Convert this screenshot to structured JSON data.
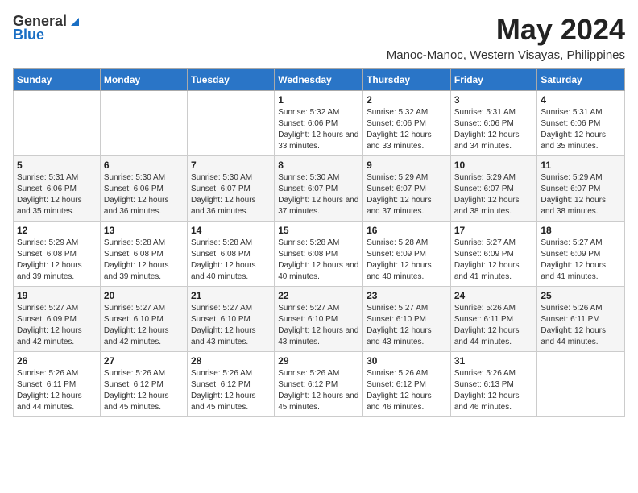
{
  "logo": {
    "general": "General",
    "blue": "Blue"
  },
  "title": "May 2024",
  "location": "Manoc-Manoc, Western Visayas, Philippines",
  "days_header": [
    "Sunday",
    "Monday",
    "Tuesday",
    "Wednesday",
    "Thursday",
    "Friday",
    "Saturday"
  ],
  "weeks": [
    [
      {
        "day": "",
        "content": ""
      },
      {
        "day": "",
        "content": ""
      },
      {
        "day": "",
        "content": ""
      },
      {
        "day": "1",
        "content": "Sunrise: 5:32 AM\nSunset: 6:06 PM\nDaylight: 12 hours and 33 minutes."
      },
      {
        "day": "2",
        "content": "Sunrise: 5:32 AM\nSunset: 6:06 PM\nDaylight: 12 hours and 33 minutes."
      },
      {
        "day": "3",
        "content": "Sunrise: 5:31 AM\nSunset: 6:06 PM\nDaylight: 12 hours and 34 minutes."
      },
      {
        "day": "4",
        "content": "Sunrise: 5:31 AM\nSunset: 6:06 PM\nDaylight: 12 hours and 35 minutes."
      }
    ],
    [
      {
        "day": "5",
        "content": "Sunrise: 5:31 AM\nSunset: 6:06 PM\nDaylight: 12 hours and 35 minutes."
      },
      {
        "day": "6",
        "content": "Sunrise: 5:30 AM\nSunset: 6:06 PM\nDaylight: 12 hours and 36 minutes."
      },
      {
        "day": "7",
        "content": "Sunrise: 5:30 AM\nSunset: 6:07 PM\nDaylight: 12 hours and 36 minutes."
      },
      {
        "day": "8",
        "content": "Sunrise: 5:30 AM\nSunset: 6:07 PM\nDaylight: 12 hours and 37 minutes."
      },
      {
        "day": "9",
        "content": "Sunrise: 5:29 AM\nSunset: 6:07 PM\nDaylight: 12 hours and 37 minutes."
      },
      {
        "day": "10",
        "content": "Sunrise: 5:29 AM\nSunset: 6:07 PM\nDaylight: 12 hours and 38 minutes."
      },
      {
        "day": "11",
        "content": "Sunrise: 5:29 AM\nSunset: 6:07 PM\nDaylight: 12 hours and 38 minutes."
      }
    ],
    [
      {
        "day": "12",
        "content": "Sunrise: 5:29 AM\nSunset: 6:08 PM\nDaylight: 12 hours and 39 minutes."
      },
      {
        "day": "13",
        "content": "Sunrise: 5:28 AM\nSunset: 6:08 PM\nDaylight: 12 hours and 39 minutes."
      },
      {
        "day": "14",
        "content": "Sunrise: 5:28 AM\nSunset: 6:08 PM\nDaylight: 12 hours and 40 minutes."
      },
      {
        "day": "15",
        "content": "Sunrise: 5:28 AM\nSunset: 6:08 PM\nDaylight: 12 hours and 40 minutes."
      },
      {
        "day": "16",
        "content": "Sunrise: 5:28 AM\nSunset: 6:09 PM\nDaylight: 12 hours and 40 minutes."
      },
      {
        "day": "17",
        "content": "Sunrise: 5:27 AM\nSunset: 6:09 PM\nDaylight: 12 hours and 41 minutes."
      },
      {
        "day": "18",
        "content": "Sunrise: 5:27 AM\nSunset: 6:09 PM\nDaylight: 12 hours and 41 minutes."
      }
    ],
    [
      {
        "day": "19",
        "content": "Sunrise: 5:27 AM\nSunset: 6:09 PM\nDaylight: 12 hours and 42 minutes."
      },
      {
        "day": "20",
        "content": "Sunrise: 5:27 AM\nSunset: 6:10 PM\nDaylight: 12 hours and 42 minutes."
      },
      {
        "day": "21",
        "content": "Sunrise: 5:27 AM\nSunset: 6:10 PM\nDaylight: 12 hours and 43 minutes."
      },
      {
        "day": "22",
        "content": "Sunrise: 5:27 AM\nSunset: 6:10 PM\nDaylight: 12 hours and 43 minutes."
      },
      {
        "day": "23",
        "content": "Sunrise: 5:27 AM\nSunset: 6:10 PM\nDaylight: 12 hours and 43 minutes."
      },
      {
        "day": "24",
        "content": "Sunrise: 5:26 AM\nSunset: 6:11 PM\nDaylight: 12 hours and 44 minutes."
      },
      {
        "day": "25",
        "content": "Sunrise: 5:26 AM\nSunset: 6:11 PM\nDaylight: 12 hours and 44 minutes."
      }
    ],
    [
      {
        "day": "26",
        "content": "Sunrise: 5:26 AM\nSunset: 6:11 PM\nDaylight: 12 hours and 44 minutes."
      },
      {
        "day": "27",
        "content": "Sunrise: 5:26 AM\nSunset: 6:12 PM\nDaylight: 12 hours and 45 minutes."
      },
      {
        "day": "28",
        "content": "Sunrise: 5:26 AM\nSunset: 6:12 PM\nDaylight: 12 hours and 45 minutes."
      },
      {
        "day": "29",
        "content": "Sunrise: 5:26 AM\nSunset: 6:12 PM\nDaylight: 12 hours and 45 minutes."
      },
      {
        "day": "30",
        "content": "Sunrise: 5:26 AM\nSunset: 6:12 PM\nDaylight: 12 hours and 46 minutes."
      },
      {
        "day": "31",
        "content": "Sunrise: 5:26 AM\nSunset: 6:13 PM\nDaylight: 12 hours and 46 minutes."
      },
      {
        "day": "",
        "content": ""
      }
    ]
  ]
}
